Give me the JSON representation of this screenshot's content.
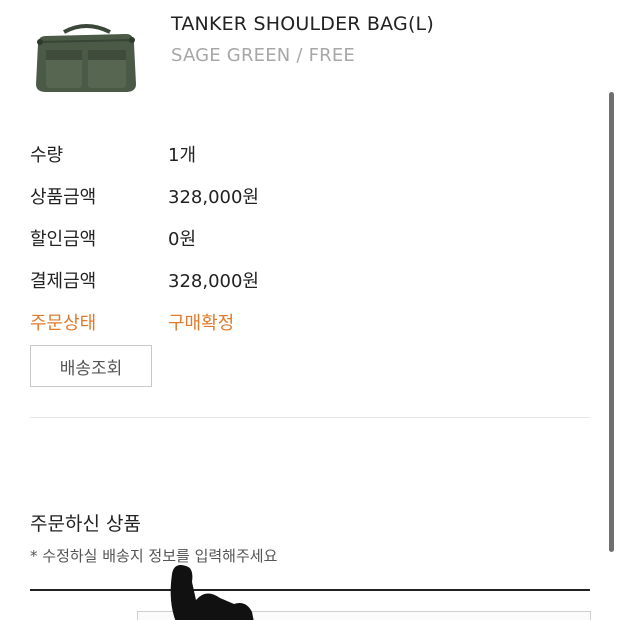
{
  "product": {
    "name": "TANKER SHOULDER BAG(L)",
    "option": "SAGE GREEN / FREE",
    "image_icon": "bag-thumbnail",
    "bag_color": "#4b5a46"
  },
  "order_info": {
    "quantity_label": "수량",
    "quantity_value": "1개",
    "price_label": "상품금액",
    "price_value": "328,000원",
    "discount_label": "할인금액",
    "discount_value": "0원",
    "payment_label": "결제금액",
    "payment_value": "328,000원",
    "status_label": "주문상태",
    "status_value": "구매확정",
    "status_color": "#e07b2e"
  },
  "actions": {
    "shipping_lookup_label": "배송조회"
  },
  "ordered_products": {
    "title": "주문하신 상품",
    "note": "* 수정하실 배송지 정보를 입력해주세요"
  }
}
